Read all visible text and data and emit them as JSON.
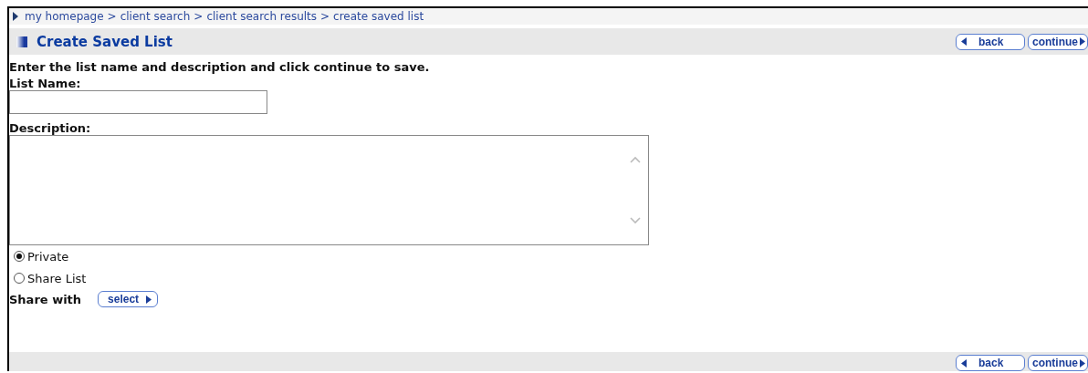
{
  "breadcrumb": {
    "items": [
      "my homepage",
      "client search",
      "client search results",
      "create saved list"
    ],
    "separator": ">"
  },
  "title": "Create Saved List",
  "header_buttons": [
    {
      "label": "back",
      "kind": "back"
    },
    {
      "label": "continue",
      "kind": "continue"
    }
  ],
  "instructions": "Enter the list name and description and click continue to save.",
  "list_name": {
    "label": "List Name:"
  },
  "description": {
    "label": "Description:"
  },
  "sharing": [
    {
      "label": "Private",
      "selected": true
    },
    {
      "label": "Share List",
      "selected": false
    }
  ],
  "share_with": {
    "label": "Share with",
    "button": "select"
  },
  "footer_buttons": [
    {
      "label": "back",
      "kind": "back"
    },
    {
      "label": "continue",
      "kind": "continue"
    }
  ]
}
